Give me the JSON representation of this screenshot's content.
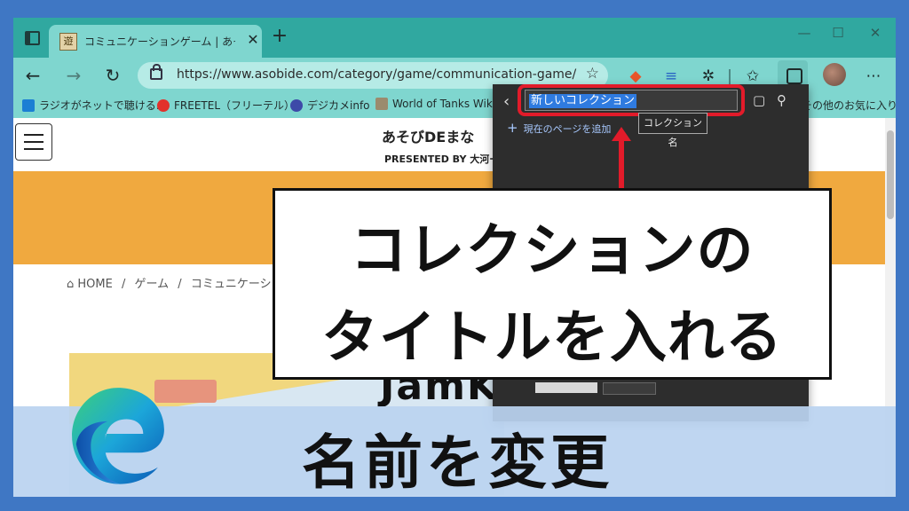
{
  "browser": {
    "tab_title": "コミュニケーションゲーム | あそびdeまな",
    "tab_favicon": "遊",
    "url": "https://www.asobide.com/category/game/communication-game/",
    "window_controls": {
      "minimize": "—",
      "maximize": "☐",
      "close": "✕"
    }
  },
  "bookmarks": [
    {
      "label": "ラジオがネットで聴ける…",
      "color": "#1b7fd4"
    },
    {
      "label": "FREETEL（フリーテル）",
      "color": "#e2312b"
    },
    {
      "label": "デジカメinfo",
      "color": "#3d4aa8"
    },
    {
      "label": "World of Tanks Wiki",
      "color": "#9b8b6e"
    },
    {
      "label": "その他のお気に入り",
      "color": "#f0b040"
    }
  ],
  "page": {
    "site_title": "あそびDEまな",
    "site_subtitle": "PRESENTED BY 大河ー",
    "breadcrumb": [
      "HOME",
      "ゲーム",
      "コミュニケーシ"
    ],
    "hero_text": "JamK"
  },
  "collections_panel": {
    "name_value": "新しいコレクション",
    "add_current_page": "現在のページを追加",
    "tooltip": "コレクション名"
  },
  "callout": {
    "line1": "コレクションの",
    "line2": "タイトルを入れる"
  },
  "caption": "名前を変更",
  "colors": {
    "frame": "#3f77c4",
    "tabbar": "#30a8a0",
    "toolbar": "#7fd6cf",
    "banner": "#f0a93f",
    "highlight_red": "#e21b2a",
    "selection_blue": "#2f7be0"
  }
}
